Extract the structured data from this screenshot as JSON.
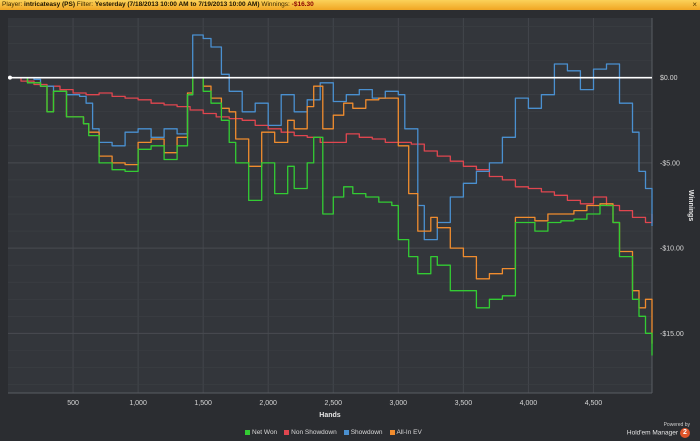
{
  "header": {
    "player_label": "Player:",
    "player": "intricateasy (PS)",
    "filter_label": "Filter:",
    "filter": "Yesterday (7/18/2013 10:00 AM to 7/19/2013 10:00 AM)",
    "winnings_label": "Winnings:",
    "winnings": "-$16.30",
    "close_glyph": "×"
  },
  "branding": {
    "powered": "Powered by",
    "product": "Hold'em Manager",
    "version": "2"
  },
  "chart_data": {
    "type": "line",
    "title": "",
    "xlabel": "Hands",
    "ylabel": "Winnings",
    "xlim": [
      0,
      4950
    ],
    "ylim": [
      -18.5,
      3.5
    ],
    "xticks": [
      500,
      1000,
      1500,
      2000,
      2500,
      3000,
      3500,
      4000,
      4500
    ],
    "xtick_labels": [
      "500",
      "1,000",
      "1,500",
      "2,000",
      "2,500",
      "3,000",
      "3,500",
      "4,000",
      "4,500"
    ],
    "yticks": [
      0,
      -5,
      -10,
      -15
    ],
    "ytick_labels": [
      "$0.00",
      "-$5.00",
      "-$10.00",
      "-$15.00"
    ],
    "y_axis_side": "right",
    "grid": true,
    "legend_position": "bottom",
    "zero_line": true,
    "series": [
      {
        "name": "Net Won",
        "color": "#33cc33",
        "x": [
          0,
          150,
          250,
          300,
          350,
          450,
          580,
          620,
          700,
          800,
          900,
          1000,
          1100,
          1200,
          1300,
          1380,
          1420,
          1500,
          1560,
          1640,
          1700,
          1750,
          1850,
          1950,
          2050,
          2150,
          2200,
          2300,
          2350,
          2420,
          2500,
          2580,
          2650,
          2750,
          2850,
          2950,
          3000,
          3080,
          3150,
          3250,
          3300,
          3400,
          3500,
          3600,
          3700,
          3800,
          3900,
          4050,
          4150,
          4250,
          4350,
          4450,
          4550,
          4650,
          4700,
          4800,
          4850,
          4900,
          4950
        ],
        "y": [
          0,
          -0.3,
          -0.5,
          -2.0,
          -0.8,
          -2.3,
          -2.7,
          -3.4,
          -5.0,
          -5.4,
          -5.5,
          -4.2,
          -4.0,
          -4.8,
          -4.0,
          -1.0,
          0,
          -0.8,
          -1.5,
          -2.5,
          -3.8,
          -5.0,
          -7.2,
          -5.0,
          -6.8,
          -5.2,
          -6.5,
          -5.0,
          -3.5,
          -8.0,
          -7.0,
          -6.4,
          -6.8,
          -7.0,
          -7.3,
          -7.5,
          -9.5,
          -10.5,
          -11.5,
          -10.5,
          -11.0,
          -12.5,
          -12.5,
          -13.5,
          -13.0,
          -12.8,
          -8.5,
          -9.0,
          -8.5,
          -8.4,
          -8.3,
          -8.0,
          -7.5,
          -8.5,
          -10.5,
          -13.0,
          -14.0,
          -15.0,
          -16.3
        ]
      },
      {
        "name": "Non Showdown",
        "color": "#e0464f",
        "x": [
          0,
          100,
          200,
          300,
          400,
          500,
          600,
          700,
          800,
          900,
          1000,
          1100,
          1200,
          1300,
          1400,
          1500,
          1600,
          1700,
          1800,
          1900,
          2000,
          2100,
          2200,
          2300,
          2400,
          2500,
          2600,
          2700,
          2800,
          2900,
          3000,
          3100,
          3200,
          3300,
          3400,
          3500,
          3600,
          3700,
          3800,
          3900,
          4000,
          4100,
          4200,
          4300,
          4400,
          4500,
          4600,
          4700,
          4800,
          4900,
          4950
        ],
        "y": [
          0,
          -0.2,
          -0.4,
          -0.5,
          -0.7,
          -0.9,
          -1.0,
          -0.9,
          -1.1,
          -1.2,
          -1.3,
          -1.5,
          -1.6,
          -1.7,
          -1.9,
          -2.1,
          -2.3,
          -2.4,
          -2.5,
          -2.8,
          -3.0,
          -3.2,
          -3.4,
          -3.5,
          -3.8,
          -3.8,
          -3.3,
          -3.5,
          -3.6,
          -3.8,
          -3.8,
          -3.9,
          -4.3,
          -4.6,
          -4.9,
          -5.2,
          -5.4,
          -5.8,
          -6.0,
          -6.4,
          -6.5,
          -6.7,
          -6.9,
          -7.2,
          -7.4,
          -7.0,
          -7.5,
          -7.8,
          -8.2,
          -8.5,
          -8.0
        ]
      },
      {
        "name": "Showdown",
        "color": "#4a90d0",
        "x": [
          0,
          100,
          200,
          250,
          350,
          450,
          550,
          600,
          650,
          700,
          800,
          900,
          1000,
          1100,
          1200,
          1300,
          1380,
          1420,
          1500,
          1560,
          1640,
          1700,
          1800,
          1900,
          2000,
          2100,
          2200,
          2300,
          2400,
          2500,
          2600,
          2700,
          2800,
          2900,
          3000,
          3050,
          3150,
          3200,
          3300,
          3400,
          3500,
          3600,
          3700,
          3800,
          3900,
          4000,
          4100,
          4200,
          4300,
          4400,
          4500,
          4600,
          4700,
          4800,
          4850,
          4900,
          4950
        ],
        "y": [
          0,
          0,
          -0.1,
          -0.5,
          -0.8,
          -1.0,
          -1.1,
          -1.5,
          -3.0,
          -3.8,
          -4.0,
          -3.2,
          -3.0,
          -3.5,
          -3.0,
          -3.3,
          -1.0,
          2.5,
          2.3,
          1.8,
          0.2,
          -0.8,
          -2.0,
          -1.5,
          -2.8,
          -1.0,
          -2.0,
          -1.3,
          -0.3,
          -1.4,
          -1.0,
          -0.7,
          -1.2,
          -0.8,
          -1.0,
          -3.0,
          -7.5,
          -9.5,
          -8.5,
          -7.0,
          -6.2,
          -5.5,
          -5.0,
          -3.5,
          -1.2,
          -1.8,
          -1.0,
          0.8,
          0.4,
          -0.7,
          0.5,
          0.8,
          -1.5,
          -3.2,
          -5.5,
          -6.5,
          -8.7
        ]
      },
      {
        "name": "All-In EV",
        "color": "#f08c2e",
        "x": [
          0,
          150,
          250,
          300,
          350,
          450,
          580,
          620,
          700,
          800,
          900,
          1000,
          1100,
          1200,
          1300,
          1380,
          1420,
          1500,
          1560,
          1640,
          1700,
          1750,
          1850,
          1950,
          2050,
          2150,
          2200,
          2300,
          2350,
          2420,
          2500,
          2580,
          2650,
          2750,
          2850,
          2950,
          3000,
          3080,
          3150,
          3250,
          3300,
          3400,
          3500,
          3600,
          3700,
          3800,
          3900,
          4050,
          4150,
          4250,
          4350,
          4450,
          4550,
          4650,
          4700,
          4800,
          4850,
          4900,
          4950
        ],
        "y": [
          0,
          -0.3,
          -0.5,
          -2.0,
          -0.8,
          -2.3,
          -2.7,
          -3.2,
          -4.6,
          -5.0,
          -5.1,
          -3.8,
          -3.6,
          -4.4,
          -3.5,
          -0.9,
          0,
          -0.5,
          -1.2,
          -1.8,
          -2.0,
          -3.6,
          -5.2,
          -3.2,
          -3.8,
          -2.5,
          -3.0,
          -1.7,
          -0.5,
          -3.0,
          -2.2,
          -1.5,
          -1.8,
          -1.3,
          -1.2,
          -1.2,
          -4.0,
          -6.8,
          -9.0,
          -8.2,
          -8.8,
          -10.0,
          -10.5,
          -11.8,
          -11.5,
          -11.2,
          -8.2,
          -8.4,
          -8.0,
          -8.0,
          -7.8,
          -7.5,
          -7.4,
          -8.5,
          -10.2,
          -12.5,
          -13.5,
          -13.0,
          -15.6
        ]
      }
    ]
  }
}
